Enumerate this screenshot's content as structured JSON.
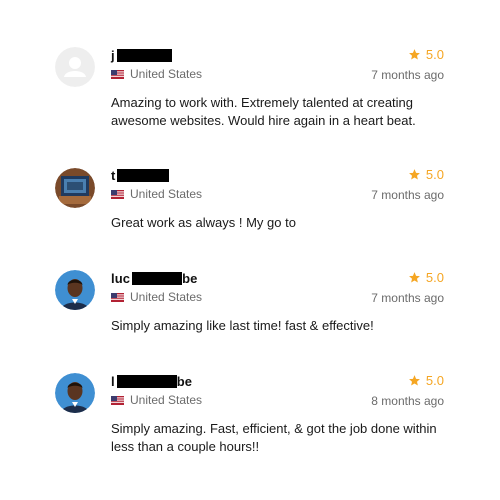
{
  "reviews": [
    {
      "name_visible": "j",
      "country": "United States",
      "rating": "5.0",
      "time": "7 months ago",
      "text": "Amazing to work with. Extremely talented at creating awesome websites. Would hire again in a heart beat.",
      "avatar": "default-avatar-icon"
    },
    {
      "name_visible": "t",
      "country": "United States",
      "rating": "5.0",
      "time": "7 months ago",
      "text": "Great work as always ! My go to",
      "avatar": "photo"
    },
    {
      "name_visible": "luc",
      "name_suffix": "be",
      "country": "United States",
      "rating": "5.0",
      "time": "7 months ago",
      "text": "Simply amazing like last time! fast & effective!",
      "avatar": "photo"
    },
    {
      "name_visible": "l",
      "name_suffix": "be",
      "country": "United States",
      "rating": "5.0",
      "time": "8 months ago",
      "text": "Simply amazing. Fast, efficient, & got the job done within less than a couple hours!!",
      "avatar": "photo"
    }
  ],
  "colors": {
    "star": "#f5a623",
    "muted": "#6b6b6b",
    "redaction": "#000000"
  }
}
